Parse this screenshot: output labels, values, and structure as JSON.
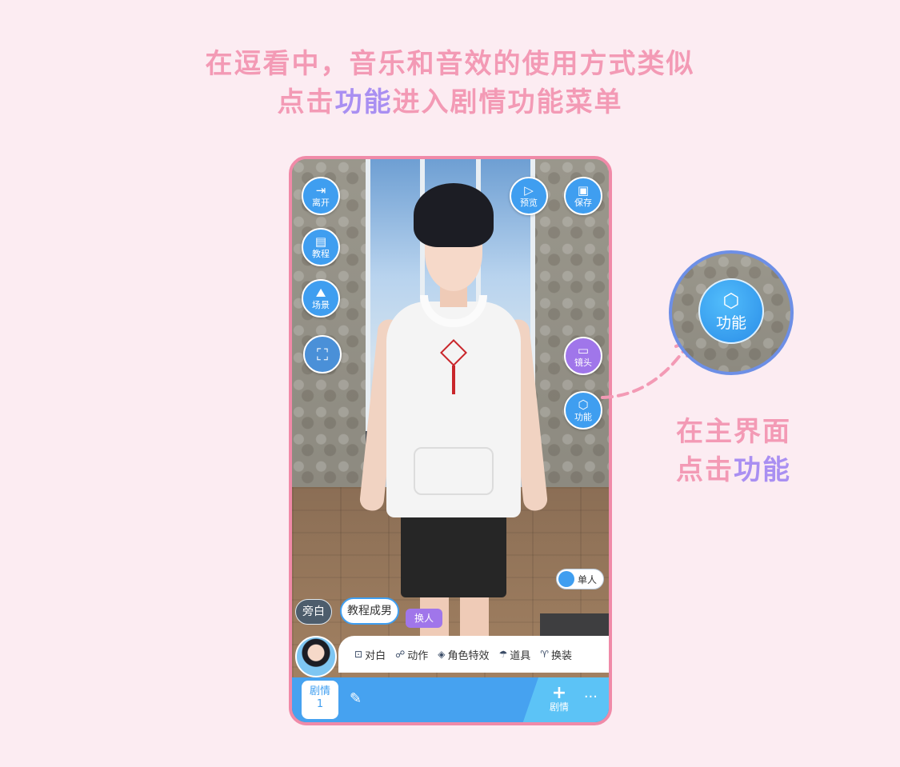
{
  "heading": {
    "line1": "在逗看中，音乐和音效的使用方式类似",
    "line2_prefix": "点击",
    "line2_highlight": "功能",
    "line2_suffix": "进入剧情功能菜单"
  },
  "left_buttons": [
    {
      "label": "离开",
      "icon": "exit-icon",
      "glyph": "⇥"
    },
    {
      "label": "教程",
      "icon": "book-icon",
      "glyph": "▤"
    },
    {
      "label": "场景",
      "icon": "scene-icon",
      "glyph": "⛰"
    },
    {
      "label": "",
      "icon": "fullscreen-icon",
      "glyph": "⛶"
    }
  ],
  "top_right_buttons": [
    {
      "label": "预览",
      "icon": "play-icon",
      "glyph": "▷"
    },
    {
      "label": "保存",
      "icon": "save-icon",
      "glyph": "▣"
    }
  ],
  "camera_button": {
    "label": "镜头",
    "icon": "camera-icon",
    "glyph": "▭"
  },
  "function_button": {
    "label": "功能",
    "icon": "cube-icon",
    "glyph": "⬡"
  },
  "toggle": {
    "label": "单人"
  },
  "narration_button": "旁白",
  "character_name": "教程成男",
  "swap_button": "换人",
  "action_bar": [
    {
      "label": "对白",
      "glyph": "⊡"
    },
    {
      "label": "动作",
      "glyph": "☍"
    },
    {
      "label": "角色特效",
      "glyph": "◈"
    },
    {
      "label": "道具",
      "glyph": "☂"
    },
    {
      "label": "换装",
      "glyph": "♈"
    }
  ],
  "story_tab": {
    "label": "剧情",
    "number": "1"
  },
  "add_story": {
    "label": "剧情",
    "plus": "+"
  },
  "more": "···",
  "callout": {
    "line1": "在主界面",
    "line2_prefix": "点击",
    "line2_highlight": "功能"
  },
  "zoom_button": {
    "label": "功能",
    "glyph": "⬡"
  },
  "colors": {
    "accent_pink": "#f39ab5",
    "accent_purple": "#a98ff2",
    "button_blue": "#3f9ef0"
  }
}
